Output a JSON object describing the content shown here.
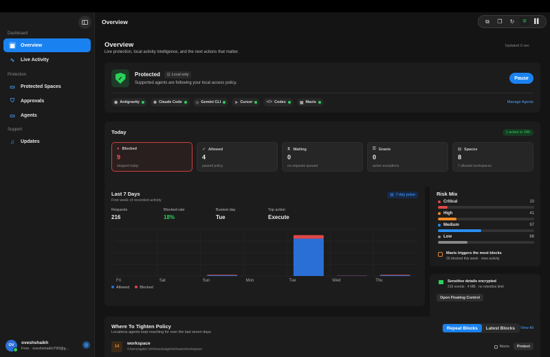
{
  "sidebar": {
    "sections": {
      "dashboard": "Dashboard",
      "protection": "Protection",
      "support": "Support"
    },
    "items": [
      {
        "label": "Overview",
        "icon": "grid-icon"
      },
      {
        "label": "Live Activity",
        "icon": "pulse-icon"
      },
      {
        "label": "Protected Spaces",
        "icon": "folder-shield-icon"
      },
      {
        "label": "Approvals",
        "icon": "approval-shield-icon"
      },
      {
        "label": "Agents",
        "icon": "monitor-icon"
      },
      {
        "label": "Updates",
        "icon": "bell-icon"
      }
    ],
    "user": {
      "initials": "OV",
      "name": "oveshshaikh",
      "sub": "Free · oveshshaikh790@g..."
    }
  },
  "header": {
    "title": "Overview"
  },
  "page": {
    "title": "Overview",
    "subtitle": "Live protection, local activity intelligence, and the next actions that matter.",
    "updated": "Updated 0 sec"
  },
  "protection": {
    "title": "Protected",
    "badge": "Local only",
    "subtitle": "Supported agents are following your local access policy.",
    "pause_label": "Pause",
    "manage_label": "Manage Agents",
    "agents": [
      {
        "name": "Antigravity",
        "icon": "⬢"
      },
      {
        "name": "Claude Code",
        "icon": "✺"
      },
      {
        "name": "Gemini CLI",
        "icon": "◇"
      },
      {
        "name": "Cursor",
        "icon": "➤"
      },
      {
        "name": "Codex",
        "icon": "</>"
      },
      {
        "name": "Mavis",
        "icon": "▣"
      }
    ]
  },
  "today": {
    "title": "Today",
    "active_badge": "1 active in 24h",
    "stats": [
      {
        "label": "Blocked",
        "value": "9",
        "sub": "stopped today",
        "icon": "●"
      },
      {
        "label": "Allowed",
        "value": "4",
        "sub": "passed policy",
        "icon": "✓"
      },
      {
        "label": "Waiting",
        "value": "0",
        "sub": "no requests queued",
        "icon": "⧗"
      },
      {
        "label": "Grants",
        "value": "0",
        "sub": "active exceptions",
        "icon": "⚿"
      },
      {
        "label": "Spaces",
        "value": "8",
        "sub": "7 allowed workspaces",
        "icon": "⊟"
      }
    ]
  },
  "last7": {
    "title": "Last 7 Days",
    "subtitle": "First week of recorded activity",
    "pulse_label": "7-day pulse",
    "metrics": [
      {
        "label": "Requests",
        "value": "216"
      },
      {
        "label": "Blocked rate",
        "value": "18%"
      },
      {
        "label": "Busiest day",
        "value": "Tue"
      },
      {
        "label": "Top action",
        "value": "Execute"
      }
    ],
    "legend": {
      "allowed": "Allowed",
      "blocked": "Blocked"
    }
  },
  "chart_data": {
    "type": "bar",
    "categories": [
      "Fri",
      "Sat",
      "Sun",
      "Mon",
      "Tue",
      "Wed",
      "Thu"
    ],
    "series": [
      {
        "name": "Allowed",
        "values": [
          0,
          0,
          3,
          0,
          160,
          1,
          3
        ]
      },
      {
        "name": "Blocked",
        "values": [
          0,
          0,
          2,
          0,
          15,
          1,
          2
        ]
      }
    ],
    "ylim": [
      0,
      200
    ],
    "grid": true,
    "stacked": true,
    "colors": {
      "allowed": "#2a6fd6",
      "blocked": "#e04848"
    }
  },
  "risk_mix": {
    "title": "Risk Mix",
    "rows": [
      {
        "name": "Critical",
        "value": "10",
        "fraction": 0.1,
        "color": "#e04848"
      },
      {
        "name": "High",
        "value": "41",
        "fraction": 0.19,
        "color": "#f08a24"
      },
      {
        "name": "Medium",
        "value": "97",
        "fraction": 0.45,
        "color": "#2a8ff0"
      },
      {
        "name": "Low",
        "value": "68",
        "fraction": 0.31,
        "color": "#888888"
      }
    ],
    "insight_title": "Mavis triggers the most blocks",
    "insight_sub": "26 blocked this week · view activity"
  },
  "encryption": {
    "title": "Sensitive details encrypted",
    "sub": "216 events · 4 MB · no retention limit",
    "button": "Open Floating Control"
  },
  "tighten": {
    "title": "Where To Tighten Policy",
    "subtitle": "Locations agents kept reaching for over the last seven days",
    "tabs": [
      "Repeat Blocks",
      "Latest Blocks"
    ],
    "view_all": "View All",
    "rows": [
      {
        "count": "14",
        "name": "workspace",
        "path": "/Users/apple/.vlm/mavis/agents/mavis/workspace",
        "agent": "Mavis",
        "action": "Protect"
      }
    ]
  }
}
